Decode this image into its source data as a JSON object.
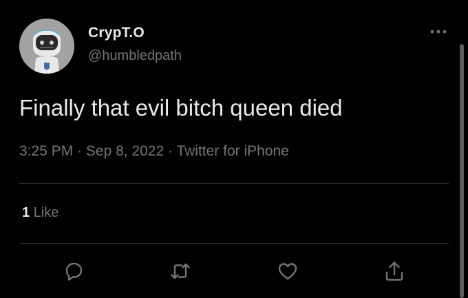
{
  "tweet": {
    "author": {
      "display_name": "CrypT.O",
      "handle": "@humbledpath",
      "avatar_icon": "robot-avatar-icon"
    },
    "text": "Finally that evil bitch queen died",
    "timestamp": {
      "time": "3:25 PM",
      "separator1": " · ",
      "date": "Sep 8, 2022",
      "separator2": " · ",
      "source": "Twitter for iPhone"
    },
    "engagement": {
      "like_count": "1",
      "like_label": "Like"
    },
    "actions": [
      {
        "name": "reply",
        "icon": "reply-icon"
      },
      {
        "name": "retweet",
        "icon": "retweet-icon"
      },
      {
        "name": "like",
        "icon": "heart-icon"
      },
      {
        "name": "share",
        "icon": "share-icon"
      }
    ]
  },
  "colors": {
    "background": "#000000",
    "primary_text": "#e7e9ea",
    "secondary_text": "#71767b",
    "divider": "#2f3336"
  }
}
